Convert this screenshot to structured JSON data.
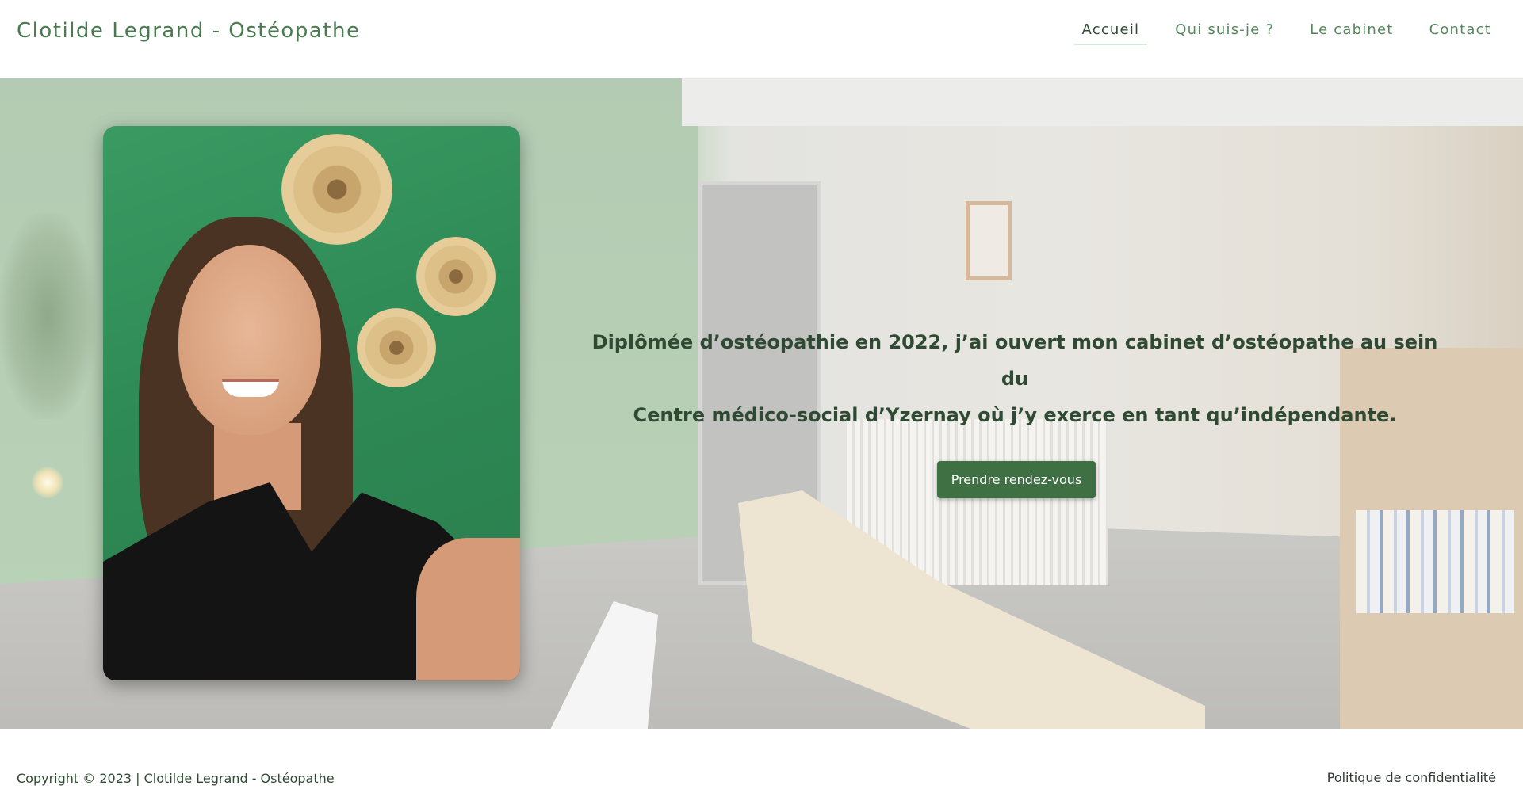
{
  "header": {
    "site_title": "Clotilde Legrand - Ostéopathe",
    "nav": [
      {
        "label": "Accueil",
        "active": true
      },
      {
        "label": "Qui suis-je ?",
        "active": false
      },
      {
        "label": "Le cabinet",
        "active": false
      },
      {
        "label": "Contact",
        "active": false
      }
    ]
  },
  "hero": {
    "text_line1": "Diplômée d’ostéopathie en 2022, j’ai ouvert mon cabinet d’ostéopathe au sein du",
    "text_line2": "Centre médico-social d’Yzernay où j’y exerce en tant qu’indépendante.",
    "cta_label": "Prendre rendez-vous"
  },
  "footer": {
    "copyright": "Copyright © 2023 | Clotilde Legrand - Ostéopathe",
    "privacy_link": "Politique de confidentialité"
  },
  "colors": {
    "brand_green": "#3f7043",
    "text_dark_green": "#2f4a33",
    "nav_green": "#55865c"
  }
}
